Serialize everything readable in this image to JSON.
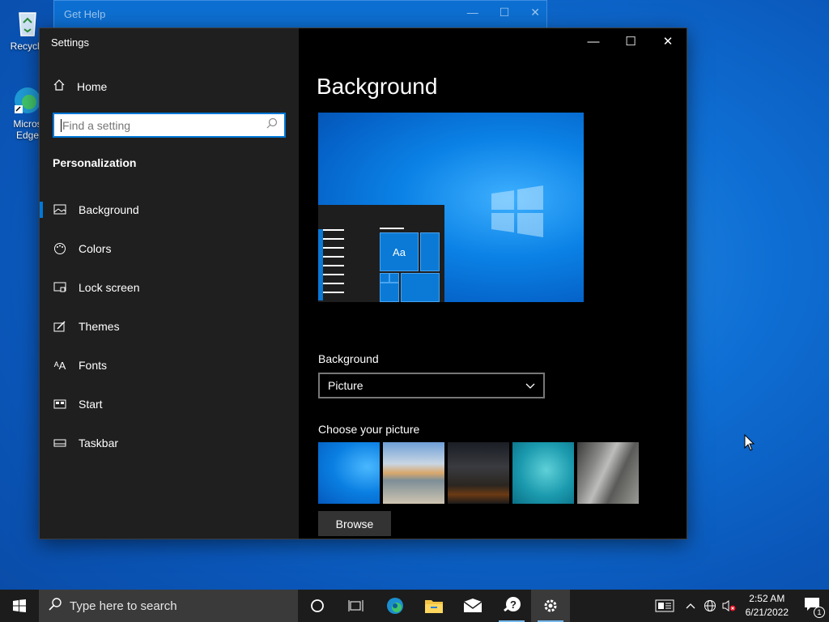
{
  "desktop": {
    "icons": [
      {
        "label": "Recycle",
        "icon": "recycle-bin-icon"
      },
      {
        "label": "Micros Edge",
        "icon": "edge-shortcut-icon"
      }
    ],
    "background_window": {
      "title": "Get Help"
    }
  },
  "window": {
    "title": "Settings",
    "controls": {
      "minimize": "—",
      "maximize": "☐",
      "close": "✕"
    }
  },
  "sidebar": {
    "home_label": "Home",
    "search_placeholder": "Find a setting",
    "section_title": "Personalization",
    "items": [
      {
        "label": "Background",
        "icon": "picture-icon",
        "active": true
      },
      {
        "label": "Colors",
        "icon": "palette-icon",
        "active": false
      },
      {
        "label": "Lock screen",
        "icon": "lock-screen-icon",
        "active": false
      },
      {
        "label": "Themes",
        "icon": "themes-icon",
        "active": false
      },
      {
        "label": "Fonts",
        "icon": "fonts-icon",
        "active": false
      },
      {
        "label": "Start",
        "icon": "start-icon",
        "active": false
      },
      {
        "label": "Taskbar",
        "icon": "taskbar-icon",
        "active": false
      }
    ]
  },
  "main": {
    "title": "Background",
    "preview": {
      "tile_text": "Aa"
    },
    "background_label": "Background",
    "background_value": "Picture",
    "choose_label": "Choose your picture",
    "pictures": [
      "windows-default",
      "beach-rocks",
      "night-sky-tent",
      "underwater-swimmer",
      "rock-cliff"
    ],
    "browse_label": "Browse"
  },
  "taskbar": {
    "search_placeholder": "Type here to search",
    "apps": [
      {
        "name": "cortana-icon",
        "running": false,
        "active": false
      },
      {
        "name": "task-view-icon",
        "running": false,
        "active": false
      },
      {
        "name": "edge-icon",
        "running": false,
        "active": false
      },
      {
        "name": "file-explorer-icon",
        "running": false,
        "active": false
      },
      {
        "name": "mail-icon",
        "running": false,
        "active": false
      },
      {
        "name": "get-help-icon",
        "running": true,
        "active": false
      },
      {
        "name": "settings-icon",
        "running": true,
        "active": true
      }
    ],
    "time": "2:52 AM",
    "date": "6/21/2022",
    "notification_count": "1"
  },
  "colors": {
    "accent": "#0078d7",
    "sidebar": "#1f1f1f",
    "content": "#000000",
    "taskbar": "#1c1c1c"
  }
}
